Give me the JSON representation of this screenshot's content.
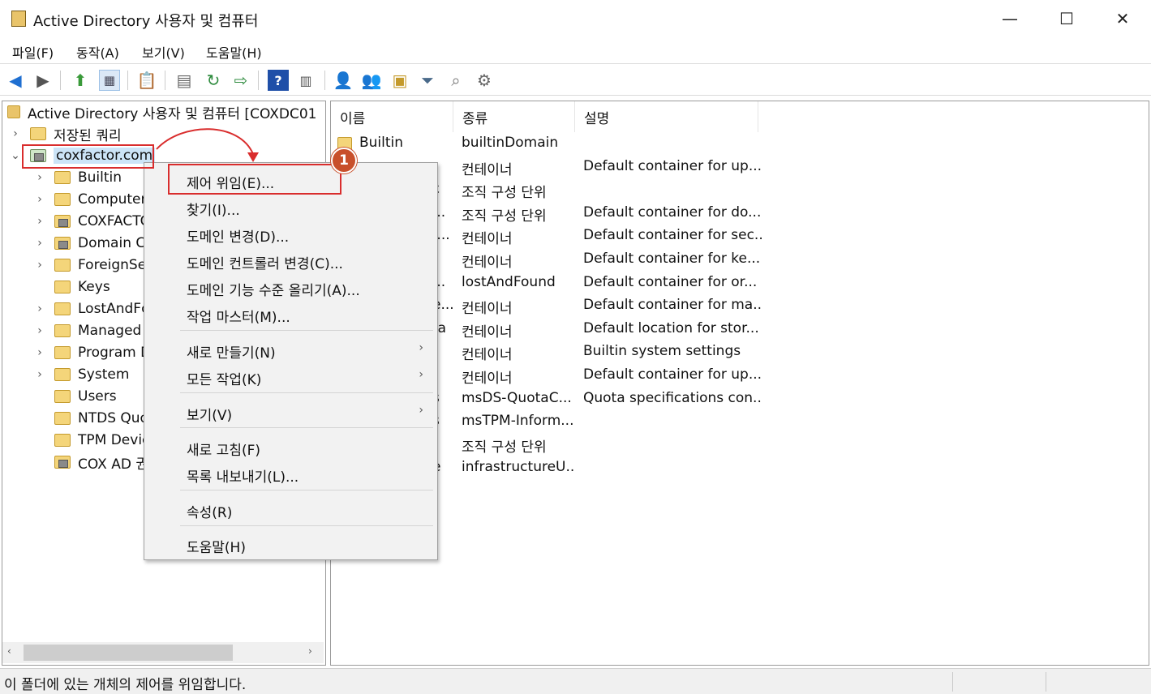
{
  "window": {
    "title": "Active Directory 사용자 및 컴퓨터",
    "minimize": "—",
    "maximize": "☐",
    "close": "✕"
  },
  "menu": {
    "file": "파일(F)",
    "action": "동작(A)",
    "view": "보기(V)",
    "help": "도움말(H)"
  },
  "toolbar": {
    "icons": [
      "back-arrow-icon",
      "forward-arrow-icon",
      "up-folder-icon",
      "show-tree-icon",
      "clipboard-icon",
      "properties-icon",
      "refresh-icon",
      "export-list-icon",
      "help-icon",
      "console-view-icon",
      "new-user-icon",
      "new-group-icon",
      "new-ou-icon",
      "filter-icon",
      "find-icon",
      "add-to-group-icon"
    ]
  },
  "tree": {
    "root": "Active Directory 사용자 및 컴퓨터 [COXDC01",
    "saved_queries": "저장된 쿼리",
    "domain": "coxfactor.com",
    "children": [
      "Builtin",
      "Computers",
      "COXFACTC",
      "Domain Cc",
      "ForeignSec",
      "Keys",
      "LostAndFc",
      "Managed S",
      "Program D",
      "System",
      "Users",
      "NTDS Quo",
      "TPM Devic",
      "COX AD 권"
    ]
  },
  "list": {
    "headers": {
      "name": "이름",
      "type": "종류",
      "desc": "설명"
    },
    "name_fragments": [
      "Builtin",
      "",
      "ε",
      "...",
      "r...",
      "",
      "...",
      "e...",
      "ta",
      "",
      "",
      "s",
      "s",
      "",
      "e"
    ],
    "types": [
      "builtinDomain",
      "컨테이너",
      "조직 구성 단위",
      "조직 구성 단위",
      "컨테이너",
      "컨테이너",
      "lostAndFound",
      "컨테이너",
      "컨테이너",
      "컨테이너",
      "컨테이너",
      "msDS-QuotaC...",
      "msTPM-Inform...",
      "조직 구성 단위",
      "infrastructureU..."
    ],
    "descriptions": [
      "",
      "Default container for up...",
      "",
      "Default container for do...",
      "Default container for sec...",
      "Default container for ke...",
      "Default container for or...",
      "Default container for ma...",
      "Default location for stor...",
      "Builtin system settings",
      "Default container for up...",
      "Quota specifications con...",
      "",
      "",
      ""
    ]
  },
  "context_menu": {
    "delegate": "제어 위임(E)...",
    "find": "찾기(I)...",
    "change_domain": "도메인 변경(D)...",
    "change_dc": "도메인 컨트롤러 변경(C)...",
    "raise_level": "도메인 기능 수준 올리기(A)...",
    "operations_masters": "작업 마스터(M)...",
    "new": "새로 만들기(N)",
    "all_tasks": "모든 작업(K)",
    "view": "보기(V)",
    "refresh": "새로 고침(F)",
    "export": "목록 내보내기(L)...",
    "properties": "속성(R)",
    "help": "도움말(H)",
    "submenu_arrow": "›"
  },
  "annotation": {
    "step": "1"
  },
  "status": {
    "text": "이 폴더에 있는 개체의 제어를 위임합니다."
  }
}
